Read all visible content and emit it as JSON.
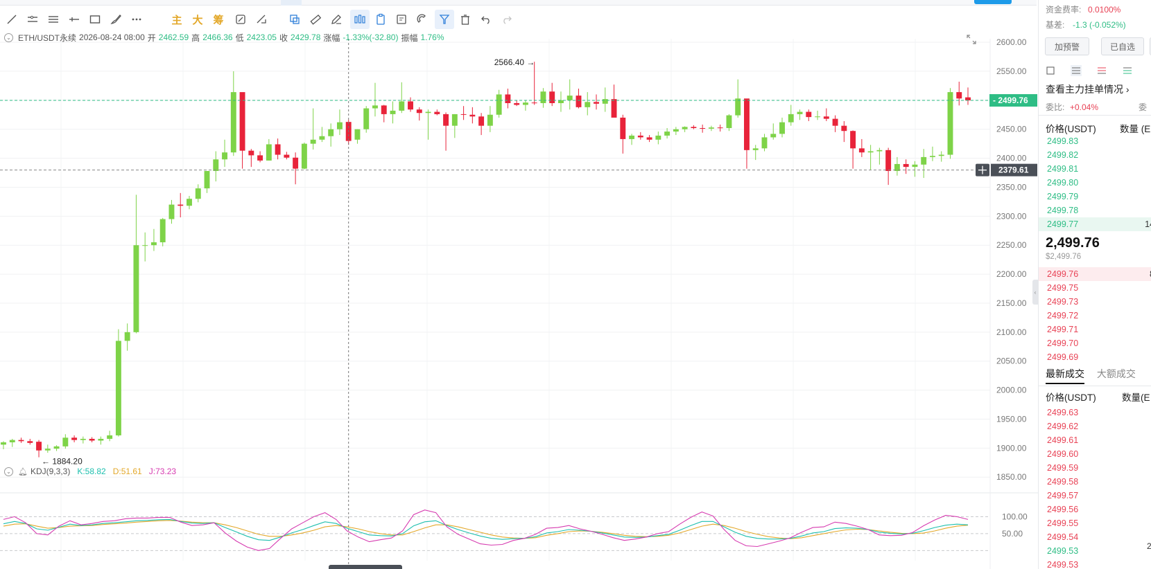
{
  "toolbar": {
    "tools": [
      "trend-line",
      "parallel-lines",
      "horizontal-lines",
      "horizontal-ray",
      "rectangle",
      "brush",
      "more",
      "主",
      "大",
      "筹",
      "mirror",
      "measure-tool",
      "box-select",
      "ruler",
      "pen-edit",
      "bar-pattern",
      "clipboard",
      "screenshot-text",
      "magnet",
      "filter",
      "trash",
      "undo",
      "redo"
    ],
    "cjk": [
      "主",
      "大",
      "筹"
    ]
  },
  "info": {
    "symbol": "ETH/USDT永续",
    "datetime": "2026-08-24 08:00",
    "open_label": "开",
    "open": "2462.59",
    "high_label": "高",
    "high": "2466.36",
    "low_label": "低",
    "low": "2423.05",
    "close_label": "收",
    "close": "2429.78",
    "change_label": "涨幅",
    "change": "-1.33%(-32.80)",
    "amp_label": "振幅",
    "amp": "1.76%"
  },
  "kdj": {
    "title": "KDJ(9,3,3)",
    "k": "K:58.82",
    "d": "D:51.61",
    "j": "J:73.23"
  },
  "chart_data": {
    "type": "candlestick",
    "y_axis_ticks": [
      "2600.00",
      "2550.00",
      "2500.00",
      "2450.00",
      "2400.00",
      "2350.00",
      "2300.00",
      "2250.00",
      "2200.00",
      "2150.00",
      "2100.00",
      "2050.00",
      "2000.00",
      "1950.00",
      "1900.00",
      "1850.00"
    ],
    "ylim": [
      1830,
      2612
    ],
    "candles": [
      [
        1906,
        1912,
        1898,
        1910
      ],
      [
        1910,
        1916,
        1902,
        1914
      ],
      [
        1914,
        1918,
        1909,
        1912
      ],
      [
        1912,
        1916,
        1906,
        1909
      ],
      [
        1911,
        1914,
        1884.2,
        1896
      ],
      [
        1896,
        1906,
        1892,
        1899
      ],
      [
        1899,
        1905,
        1895,
        1903
      ],
      [
        1903,
        1924,
        1899,
        1918
      ],
      [
        1918,
        1922,
        1910,
        1914
      ],
      [
        1914,
        1920,
        1908,
        1916
      ],
      [
        1916,
        1919,
        1910,
        1913
      ],
      [
        1913,
        1920,
        1906,
        1916
      ],
      [
        1916,
        1930,
        1912,
        1922
      ],
      [
        1922,
        2105,
        1920,
        2085
      ],
      [
        2085,
        2115,
        2068,
        2100
      ],
      [
        2100,
        2337,
        2098,
        2250
      ],
      [
        2250,
        2272,
        2222,
        2250
      ],
      [
        2250,
        2278,
        2240,
        2255
      ],
      [
        2255,
        2297,
        2248,
        2295
      ],
      [
        2295,
        2328,
        2287,
        2320
      ],
      [
        2320,
        2340,
        2298,
        2318
      ],
      [
        2318,
        2335,
        2312,
        2330
      ],
      [
        2330,
        2355,
        2324,
        2348
      ],
      [
        2348,
        2378,
        2340,
        2378
      ],
      [
        2378,
        2412,
        2360,
        2398
      ],
      [
        2398,
        2432,
        2385,
        2410
      ],
      [
        2410,
        2550,
        2404,
        2514
      ],
      [
        2514,
        2505,
        2382,
        2413
      ],
      [
        2413,
        2416,
        2385,
        2405
      ],
      [
        2405,
        2412,
        2393,
        2396
      ],
      [
        2396,
        2433,
        2396,
        2424
      ],
      [
        2424,
        2434,
        2398,
        2406
      ],
      [
        2406,
        2411,
        2398,
        2401
      ],
      [
        2401,
        2410,
        2355,
        2382
      ],
      [
        2382,
        2427,
        2381,
        2425
      ],
      [
        2425,
        2486,
        2415,
        2432
      ],
      [
        2432,
        2454,
        2428,
        2438
      ],
      [
        2438,
        2460,
        2420,
        2450
      ],
      [
        2450,
        2484,
        2440,
        2462
      ],
      [
        2462.59,
        2466.36,
        2423.05,
        2429.78
      ],
      [
        2432,
        2450,
        2425,
        2450
      ],
      [
        2450,
        2490,
        2444,
        2486
      ],
      [
        2486,
        2530,
        2472,
        2491
      ],
      [
        2491,
        2492,
        2462,
        2476
      ],
      [
        2476,
        2498,
        2460,
        2482
      ],
      [
        2482,
        2531,
        2478,
        2498
      ],
      [
        2498,
        2505,
        2480,
        2484
      ],
      [
        2484,
        2488,
        2465,
        2478
      ],
      [
        2478,
        2484,
        2432,
        2480
      ],
      [
        2480,
        2484,
        2474,
        2476
      ],
      [
        2476,
        2479,
        2413,
        2456
      ],
      [
        2456,
        2476,
        2435,
        2476
      ],
      [
        2476,
        2490,
        2466,
        2475
      ],
      [
        2475,
        2488,
        2460,
        2472
      ],
      [
        2472,
        2478,
        2440,
        2456
      ],
      [
        2456,
        2490,
        2445,
        2475
      ],
      [
        2475,
        2518,
        2470,
        2510
      ],
      [
        2510,
        2520,
        2486,
        2495
      ],
      [
        2495,
        2500,
        2490,
        2492
      ],
      [
        2492,
        2500,
        2482,
        2496
      ],
      [
        2496,
        2566.4,
        2492,
        2495
      ],
      [
        2495,
        2521,
        2487,
        2515
      ],
      [
        2515,
        2530,
        2490,
        2495
      ],
      [
        2495,
        2515,
        2480,
        2500
      ],
      [
        2500,
        2536,
        2484,
        2508
      ],
      [
        2508,
        2520,
        2486,
        2488
      ],
      [
        2488,
        2514,
        2474,
        2497
      ],
      [
        2497,
        2510,
        2484,
        2494
      ],
      [
        2494,
        2522,
        2480,
        2502
      ],
      [
        2502,
        2527,
        2471,
        2470
      ],
      [
        2470,
        2475,
        2408,
        2433
      ],
      [
        2433,
        2442,
        2423,
        2439
      ],
      [
        2439,
        2445,
        2432,
        2436
      ],
      [
        2436,
        2440,
        2428,
        2432
      ],
      [
        2432,
        2446,
        2424,
        2439
      ],
      [
        2439,
        2452,
        2434,
        2446
      ],
      [
        2446,
        2454,
        2440,
        2450
      ],
      [
        2450,
        2455,
        2445,
        2454
      ],
      [
        2454,
        2457,
        2450,
        2452
      ],
      [
        2452,
        2458,
        2444,
        2451
      ],
      [
        2451,
        2456,
        2447,
        2453
      ],
      [
        2453,
        2458,
        2446,
        2452
      ],
      [
        2452,
        2476,
        2447,
        2474
      ],
      [
        2474,
        2536,
        2470,
        2503
      ],
      [
        2503,
        2502,
        2382,
        2414
      ],
      [
        2414,
        2423,
        2397,
        2417
      ],
      [
        2417,
        2442,
        2412,
        2436
      ],
      [
        2436,
        2460,
        2432,
        2442
      ],
      [
        2442,
        2470,
        2436,
        2462
      ],
      [
        2462,
        2492,
        2456,
        2476
      ],
      [
        2476,
        2484,
        2466,
        2480
      ],
      [
        2480,
        2484,
        2464,
        2471
      ],
      [
        2471,
        2482,
        2466,
        2472
      ],
      [
        2472,
        2486,
        2464,
        2468
      ],
      [
        2468,
        2474,
        2445,
        2456
      ],
      [
        2456,
        2464,
        2428,
        2447
      ],
      [
        2447,
        2448,
        2382,
        2417
      ],
      [
        2417,
        2433,
        2402,
        2410
      ],
      [
        2410,
        2423,
        2380,
        2412
      ],
      [
        2412,
        2418,
        2389,
        2414
      ],
      [
        2414,
        2418,
        2354,
        2378
      ],
      [
        2378,
        2402,
        2370,
        2390
      ],
      [
        2390,
        2398,
        2373,
        2385
      ],
      [
        2385,
        2395,
        2368,
        2389
      ],
      [
        2389,
        2416,
        2366,
        2402
      ],
      [
        2402,
        2420,
        2395,
        2404
      ],
      [
        2404,
        2412,
        2394,
        2406
      ],
      [
        2406,
        2521,
        2399,
        2514
      ],
      [
        2514,
        2532,
        2491,
        2503
      ],
      [
        2505,
        2522,
        2492,
        2499.76
      ]
    ],
    "price_line": "2499.76",
    "crosshair_price": "2379.61",
    "max_label": "2566.40",
    "min_label": "1884.20",
    "kdj_ticks": [
      "100.00",
      "50.00"
    ],
    "kdj_ylim": [
      -30,
      150
    ],
    "K": [
      79,
      86,
      80,
      64,
      60,
      69,
      78,
      74,
      76,
      80,
      82,
      85,
      88,
      89,
      91,
      92,
      86,
      81,
      80,
      82,
      68,
      55,
      42,
      32,
      30,
      40,
      52,
      62,
      74,
      85,
      80,
      66,
      56,
      46,
      44,
      43,
      50,
      73,
      85,
      88,
      74,
      62,
      52,
      43,
      36,
      33,
      35,
      36,
      41,
      52,
      56,
      62,
      60,
      57,
      52,
      46,
      40,
      39,
      40,
      44,
      48,
      60,
      74,
      86,
      86,
      70,
      54,
      42,
      36,
      34,
      34,
      36,
      43,
      52,
      56,
      65,
      67,
      66,
      62,
      54,
      51,
      49,
      51,
      58.82,
      68,
      75,
      78,
      76
    ],
    "D": [
      72,
      78,
      79,
      72,
      66,
      68,
      72,
      73,
      74,
      77,
      79,
      81,
      84,
      86,
      88,
      89,
      87,
      84,
      82,
      82,
      76,
      68,
      58,
      48,
      42,
      42,
      46,
      52,
      60,
      70,
      74,
      70,
      64,
      56,
      50,
      46,
      46,
      56,
      67,
      76,
      76,
      70,
      62,
      54,
      46,
      40,
      37,
      36,
      38,
      45,
      50,
      56,
      58,
      57,
      54,
      50,
      45,
      42,
      41,
      42,
      45,
      52,
      62,
      72,
      78,
      74,
      66,
      56,
      48,
      41,
      37,
      35,
      38,
      44,
      50,
      56,
      61,
      63,
      62,
      58,
      54,
      51,
      50,
      51.61,
      58,
      66,
      72,
      75
    ],
    "J": [
      92,
      100,
      82,
      50,
      46,
      72,
      88,
      76,
      80,
      86,
      88,
      94,
      96,
      96,
      98,
      98,
      84,
      74,
      76,
      82,
      52,
      28,
      10,
      0,
      6,
      36,
      64,
      82,
      100,
      112,
      92,
      58,
      40,
      26,
      32,
      37,
      58,
      106,
      120,
      112,
      70,
      48,
      34,
      20,
      16,
      18,
      30,
      36,
      48,
      66,
      68,
      74,
      64,
      57,
      48,
      38,
      30,
      34,
      40,
      50,
      56,
      78,
      98,
      114,
      102,
      62,
      30,
      14,
      12,
      20,
      28,
      38,
      54,
      68,
      70,
      84,
      80,
      72,
      62,
      46,
      44,
      45,
      53,
      73.23,
      90,
      104,
      100,
      92
    ]
  },
  "panel": {
    "funding_label": "资金费率:",
    "funding_value": "0.0100%",
    "basis_label": "基差:",
    "basis_value": "-1.3 (-0.052%)",
    "alert_button": "加预警",
    "watch_button": "已自选",
    "mainforce_link": "查看主力挂单情况",
    "ratio_label": "委比:",
    "ratio_value": "+0.04%",
    "ratio_right": "委",
    "price_header": "价格(USDT)",
    "qty_header": "数量 (E",
    "asks": [
      "2499.83",
      "2499.82",
      "2499.81",
      "2499.80",
      "2499.79",
      "2499.78",
      "2499.77"
    ],
    "ask_last_qty": "14",
    "last_price": "2,499.76",
    "last_price_usd": "$2,499.76",
    "bids": [
      "2499.76",
      "2499.75",
      "2499.73",
      "2499.72",
      "2499.71",
      "2499.70",
      "2499.69"
    ],
    "bid_first_qty": "8",
    "tab_latest": "最新成交",
    "tab_large": "大额成交",
    "trades_price_header": "价格(USDT)",
    "trades_qty_header": "数量(E",
    "trades": [
      {
        "p": "2499.63",
        "c": "red"
      },
      {
        "p": "2499.62",
        "c": "red"
      },
      {
        "p": "2499.61",
        "c": "red"
      },
      {
        "p": "2499.60",
        "c": "red"
      },
      {
        "p": "2499.59",
        "c": "red"
      },
      {
        "p": "2499.58",
        "c": "red"
      },
      {
        "p": "2499.57",
        "c": "red"
      },
      {
        "p": "2499.56",
        "c": "red"
      },
      {
        "p": "2499.55",
        "c": "red"
      },
      {
        "p": "2499.54",
        "c": "red"
      },
      {
        "p": "2499.53",
        "c": "green"
      },
      {
        "p": "2499.53",
        "c": "red"
      }
    ],
    "trade_qty_fragment": "2"
  },
  "colors": {
    "up": "#7ed348",
    "down": "#e8233a",
    "price_line": "#2ebd85",
    "k_line": "#1dbfae",
    "d_line": "#e3a82a",
    "j_line": "#d63bb0",
    "crosshair_tag": "#4a4f57"
  }
}
